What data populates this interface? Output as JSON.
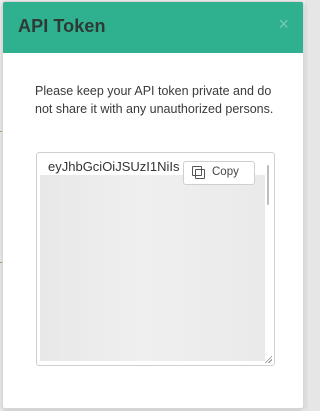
{
  "modal": {
    "title": "API Token",
    "close_glyph": "×",
    "instructions": "Please keep your API token private and do not share it with any unauthorized persons.",
    "token_preview": "eyJhbGciOiJSUzI1NiIs",
    "copy_label": "Copy",
    "icons": {
      "close": "close-icon",
      "copy": "copy-icon"
    }
  },
  "colors": {
    "header_bg": "#2fb08f",
    "title": "#2d3a36",
    "close": "#79c9b2"
  }
}
